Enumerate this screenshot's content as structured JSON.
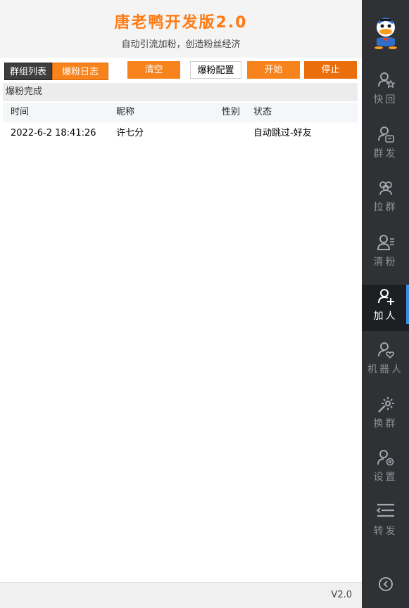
{
  "header": {
    "title": "唐老鸭开发版2.0",
    "subtitle": "自动引流加粉，创造粉丝经济"
  },
  "toolbar": {
    "tabs": [
      {
        "label": "群组列表",
        "icon": "tab-groups",
        "active": false
      },
      {
        "label": "爆粉日志",
        "icon": "tab-log",
        "active": true
      }
    ],
    "clear_label": "清空",
    "config_label": "爆粉配置",
    "start_label": "开始",
    "stop_label": "停止"
  },
  "log": {
    "status": "爆粉完成",
    "columns": [
      "时间",
      "昵称",
      "性别",
      "状态"
    ],
    "rows": [
      {
        "time": "2022-6-2 18:41:26",
        "nickname": "许七分",
        "gender": "",
        "status": "自动跳过-好友"
      }
    ]
  },
  "footer": {
    "version": "V2.0"
  },
  "sidebar": {
    "avatar": "donald-duck-avatar",
    "items": [
      {
        "label": "快回",
        "icon": "person-star-icon",
        "active": false
      },
      {
        "label": "群发",
        "icon": "person-message-icon",
        "active": false
      },
      {
        "label": "拉群",
        "icon": "group-icon",
        "active": false
      },
      {
        "label": "清粉",
        "icon": "person-list-icon",
        "active": false
      },
      {
        "label": "加人",
        "icon": "person-add-icon",
        "active": true
      },
      {
        "label": "机器人",
        "icon": "person-heart-icon",
        "active": false
      },
      {
        "label": "换群",
        "icon": "sparkle-icon",
        "active": false
      },
      {
        "label": "设置",
        "icon": "person-gear-icon",
        "active": false
      },
      {
        "label": "转发",
        "icon": "forward-list-icon",
        "active": false
      }
    ],
    "collapse_icon": "chevron-left-circle-icon"
  },
  "colors": {
    "accent": "#f7831d",
    "sidebar_bg": "#2f3135",
    "active_indicator": "#3d8de0"
  }
}
